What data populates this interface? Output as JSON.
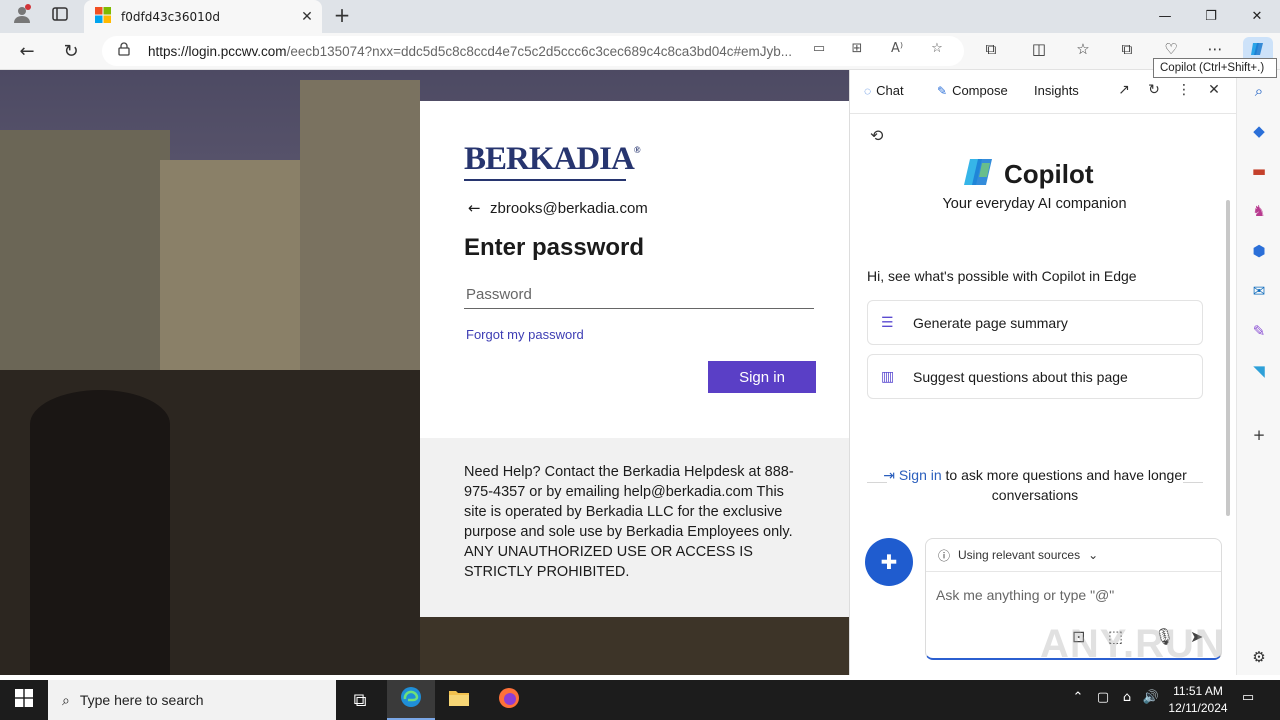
{
  "browser": {
    "tab_title": "f0dfd43c36010d",
    "url_host": "https://login.pccwv.com",
    "url_path": "/eecb135074?nxx=ddc5d5c8c8ccd4e7c5c2d5ccc6c3cec689c4c8ca3bd04c#emJyb...",
    "tooltip": "Copilot (Ctrl+Shift+.)"
  },
  "login": {
    "logo_text": "BERKADIA",
    "logo_mark": "®",
    "email": "zbrooks@berkadia.com",
    "title": "Enter password",
    "password_placeholder": "Password",
    "forgot_link": "Forgot my password",
    "signin_label": "Sign in",
    "help_text": "Need Help? Contact the Berkadia Helpdesk at 888-975-4357 or by emailing help@berkadia.com This site is operated by Berkadia LLC for the exclusive purpose and sole use by Berkadia Employees only. ANY UNAUTHORIZED USE OR ACCESS IS STRICTLY PROHIBITED."
  },
  "copilot": {
    "tabs": [
      "Chat",
      "Compose",
      "Insights"
    ],
    "brand": "Copilot",
    "tagline": "Your everyday AI companion",
    "intro": "Hi, see what's possible with Copilot in Edge",
    "suggestions": [
      "Generate page summary",
      "Suggest questions about this page"
    ],
    "signin_link": "Sign in",
    "signin_rest": " to ask more questions and have longer conversations",
    "sources_label": "Using relevant sources",
    "ask_placeholder": "Ask me anything or type \"@\""
  },
  "taskbar": {
    "search_placeholder": "Type here to search",
    "time": "11:51 AM",
    "date": "12/11/2024"
  },
  "watermark": "ANY.RUN",
  "colors": {
    "signin_button": "#5a3fc6",
    "berkadia_navy": "#27356f",
    "copilot_blue": "#1f5ccf"
  }
}
